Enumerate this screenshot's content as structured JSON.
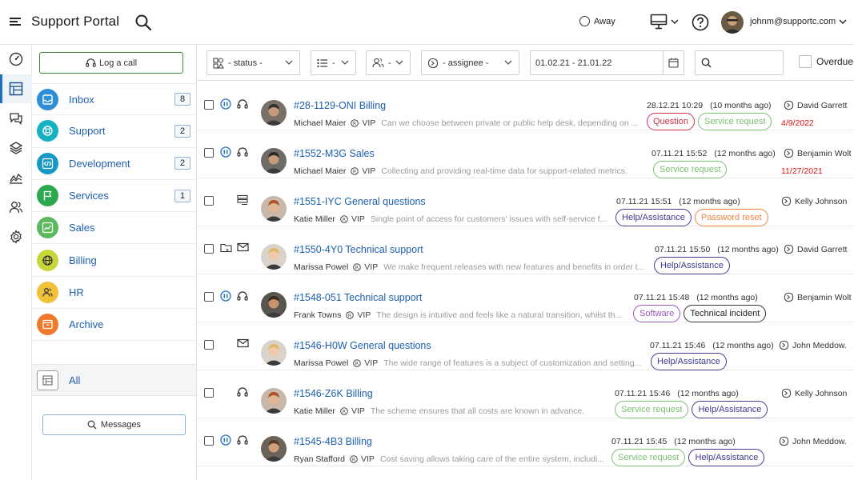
{
  "header": {
    "app_title": "Support Portal",
    "status_label": "Away",
    "user_email": "johnm@supportc.com"
  },
  "sidebar": {
    "log_call_label": "Log a call",
    "categories": [
      {
        "label": "Inbox",
        "count": "8",
        "color": "#2e8fd6"
      },
      {
        "label": "Support",
        "count": "2",
        "color": "#16b2c4"
      },
      {
        "label": "Development",
        "count": "2",
        "color": "#1698c4"
      },
      {
        "label": "Services",
        "count": "1",
        "color": "#2ea84f"
      },
      {
        "label": "Sales",
        "count": "",
        "color": "#5cb85c"
      },
      {
        "label": "Billing",
        "count": "",
        "color": "#c9d63a"
      },
      {
        "label": "HR",
        "count": "",
        "color": "#f0c23a"
      },
      {
        "label": "Archive",
        "count": "",
        "color": "#ef7a2c"
      }
    ],
    "all_label": "All",
    "messages_label": "Messages"
  },
  "filters": {
    "status": "- status -",
    "list": "-",
    "people": "-",
    "assignee": "- assignee -",
    "date_range": "01.02.21 - 21.01.22",
    "overdue_label": "Overdue"
  },
  "colors": {
    "link_blue": "#1d5fae",
    "tag_red": "#d0314a",
    "tag_green": "#7bbf72",
    "tag_purple": "#3e3a8f",
    "tag_orange": "#f08445",
    "tag_violet": "#9b59b6",
    "tag_dark": "#333333",
    "due_red": "#dd1111"
  },
  "tickets": [
    {
      "title": "#28-1129-ONI Billing",
      "person": "Michael Maier",
      "vip": "VIP",
      "snippet": "Can we choose between private or public help desk, depending on ...",
      "date": "28.12.21 10:29",
      "ago": "(10 months ago)",
      "tags": [
        {
          "label": "Question",
          "color": "#d0314a"
        },
        {
          "label": "Service request",
          "color": "#7bbf72"
        }
      ],
      "assignee": "David Garrett",
      "due": "4/9/2022",
      "icons": [
        "pause-icon",
        "headset-icon"
      ]
    },
    {
      "title": "#1552-M3G Sales",
      "person": "Michael Maier",
      "vip": "VIP",
      "snippet": "Collecting and providing real-time data for support-related metrics.",
      "date": "07.11.21 15:52",
      "ago": "(12 months ago)",
      "tags": [
        {
          "label": "Service request",
          "color": "#7bbf72"
        }
      ],
      "assignee": "Benjamin Wolt",
      "due": "11/27/2021",
      "icons": [
        "pause-icon",
        "headset-icon"
      ]
    },
    {
      "title": "#1551-IYC General questions",
      "person": "Katie Miller",
      "vip": "VIP",
      "snippet": "Single point of access for customers' issues with self-service f...",
      "date": "07.11.21 15:51",
      "ago": "(12 months ago)",
      "tags": [
        {
          "label": "Help/Assistance",
          "color": "#3e3a8f"
        },
        {
          "label": "Password reset",
          "color": "#f08445"
        }
      ],
      "assignee": "Kelly Johnson",
      "due": "",
      "icons": [
        "",
        "server-icon"
      ]
    },
    {
      "title": "#1550-4Y0 Technical support",
      "person": "Marissa Powel",
      "vip": "VIP",
      "snippet": "We make frequent releases with new features and benefits in order t...",
      "date": "07.11.21 15:50",
      "ago": "(12 months ago)",
      "tags": [
        {
          "label": "Help/Assistance",
          "color": "#3e3a8f"
        }
      ],
      "assignee": "David Garrett",
      "due": "",
      "icons": [
        "folder-icon",
        "mail-icon"
      ]
    },
    {
      "title": "#1548-051 Technical support",
      "person": "Frank Towns",
      "vip": "VIP",
      "snippet": "The design is intuitive and feels like a natural transition, whilst th...",
      "date": "07.11.21 15:48",
      "ago": "(12 months ago)",
      "tags": [
        {
          "label": "Software",
          "color": "#9b59b6"
        },
        {
          "label": "Technical incident",
          "color": "#333333"
        }
      ],
      "assignee": "Benjamin Wolt",
      "due": "",
      "icons": [
        "pause-icon",
        "headset-icon"
      ]
    },
    {
      "title": "#1546-H0W General questions",
      "person": "Marissa Powel",
      "vip": "VIP",
      "snippet": "The wide range of features is a subject of customization and setting...",
      "date": "07.11.21 15:46",
      "ago": "(12 months ago)",
      "tags": [
        {
          "label": "Help/Assistance",
          "color": "#3e3a8f"
        }
      ],
      "assignee": "John Meddow.",
      "due": "",
      "icons": [
        "",
        "mail-icon"
      ]
    },
    {
      "title": "#1546-Z6K Billing",
      "person": "Katie Miller",
      "vip": "VIP",
      "snippet": "The scheme ensures that all costs are known in advance.",
      "date": "07.11.21 15:46",
      "ago": "(12 months ago)",
      "tags": [
        {
          "label": "Service request",
          "color": "#7bbf72"
        },
        {
          "label": "Help/Assistance",
          "color": "#3e3a8f"
        }
      ],
      "assignee": "Kelly Johnson",
      "due": "",
      "icons": [
        "",
        "headset-icon"
      ]
    },
    {
      "title": "#1545-4B3 Billing",
      "person": "Ryan Stafford",
      "vip": "VIP",
      "snippet": "Cost saving allows taking care of the entire system, includi...",
      "date": "07.11.21 15:45",
      "ago": "(12 months ago)",
      "tags": [
        {
          "label": "Service request",
          "color": "#7bbf72"
        },
        {
          "label": "Help/Assistance",
          "color": "#3e3a8f"
        }
      ],
      "assignee": "John Meddow.",
      "due": "",
      "icons": [
        "pause-icon",
        "headset-icon"
      ]
    }
  ]
}
